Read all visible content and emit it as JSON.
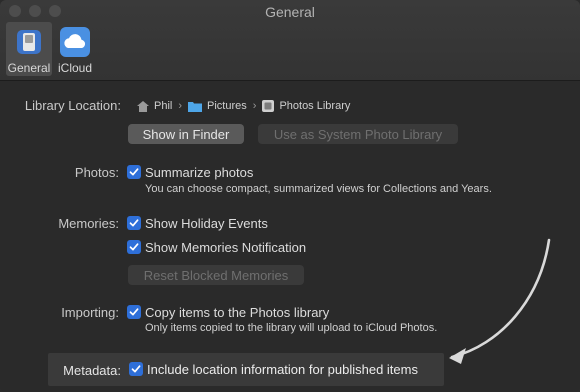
{
  "window": {
    "title": "General"
  },
  "tabs": [
    {
      "label": "General",
      "selected": true,
      "icon": "general-switch-icon"
    },
    {
      "label": "iCloud",
      "selected": false,
      "icon": "icloud-icon"
    }
  ],
  "library": {
    "label": "Library Location:",
    "path": [
      "Phil",
      "Pictures",
      "Photos Library"
    ],
    "show_in_finder": "Show in Finder",
    "use_as_system": "Use as System Photo Library"
  },
  "photos": {
    "label": "Photos:",
    "summarize": "Summarize photos",
    "summarize_checked": true,
    "description": "You can choose compact, summarized views for Collections and Years."
  },
  "memories": {
    "label": "Memories:",
    "holiday": "Show Holiday Events",
    "holiday_checked": true,
    "notification": "Show Memories Notification",
    "notification_checked": true,
    "reset": "Reset Blocked Memories"
  },
  "importing": {
    "label": "Importing:",
    "copy": "Copy items to the Photos library",
    "copy_checked": true,
    "description": "Only items copied to the library will upload to iCloud Photos."
  },
  "metadata": {
    "label": "Metadata:",
    "location": "Include location information for published items",
    "location_checked": true
  },
  "colors": {
    "accent": "#2e6fd9",
    "arrow": "#d9d9d9"
  }
}
